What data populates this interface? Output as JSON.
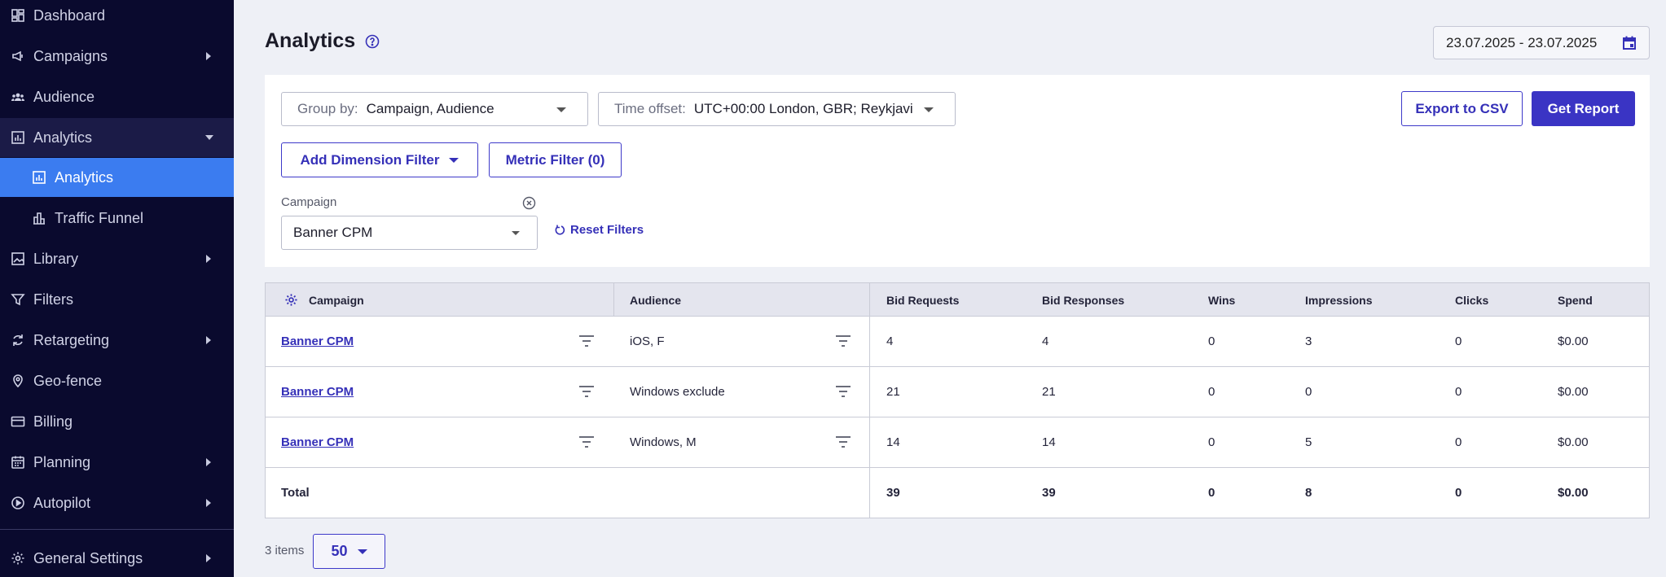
{
  "sidebar": {
    "items": [
      {
        "label": "Dashboard",
        "icon": "dashboard-icon"
      },
      {
        "label": "Campaigns",
        "icon": "megaphone-icon"
      },
      {
        "label": "Audience",
        "icon": "users-icon"
      },
      {
        "label": "Analytics",
        "icon": "chart-icon"
      },
      {
        "label": "Analytics",
        "icon": "chart-icon"
      },
      {
        "label": "Traffic Funnel",
        "icon": "funnel-chart-icon"
      },
      {
        "label": "Library",
        "icon": "image-icon"
      },
      {
        "label": "Filters",
        "icon": "filter-icon"
      },
      {
        "label": "Retargeting",
        "icon": "sync-icon"
      },
      {
        "label": "Geo-fence",
        "icon": "location-pin-icon"
      },
      {
        "label": "Billing",
        "icon": "credit-card-icon"
      },
      {
        "label": "Planning",
        "icon": "calendar-icon"
      },
      {
        "label": "Autopilot",
        "icon": "play-circle-icon"
      },
      {
        "label": "General Settings",
        "icon": "gear-icon"
      }
    ]
  },
  "header": {
    "title": "Analytics",
    "date_range": "23.07.2025 - 23.07.2025"
  },
  "filters": {
    "group_by_label": "Group by:",
    "group_by_value": "Campaign, Audience",
    "time_offset_label": "Time offset:",
    "time_offset_value": "UTC+00:00 London, GBR; Reykjavi",
    "export_label": "Export to CSV",
    "get_report_label": "Get Report",
    "add_dimension_label": "Add Dimension Filter",
    "metric_filter_label": "Metric Filter (0)",
    "campaign_field_label": "Campaign",
    "campaign_value": "Banner CPM",
    "reset_label": "Reset Filters"
  },
  "table": {
    "columns": [
      "Campaign",
      "Audience",
      "Bid Requests",
      "Bid Responses",
      "Wins",
      "Impressions",
      "Clicks",
      "Spend"
    ],
    "rows": [
      [
        "Banner CPM",
        "iOS, F",
        "4",
        "4",
        "0",
        "3",
        "0",
        "$0.00"
      ],
      [
        "Banner CPM",
        "Windows exclude",
        "21",
        "21",
        "0",
        "0",
        "0",
        "$0.00"
      ],
      [
        "Banner CPM",
        "Windows, M",
        "14",
        "14",
        "0",
        "5",
        "0",
        "$0.00"
      ]
    ],
    "total": [
      "Total",
      "",
      "39",
      "39",
      "0",
      "8",
      "0",
      "$0.00"
    ]
  },
  "footer": {
    "items_count": "3 items",
    "page_size": "50"
  },
  "colors": {
    "sidebar_bg": "#0a0a2e",
    "active_item": "#3b7cf0",
    "primary": "#3a34c4"
  }
}
